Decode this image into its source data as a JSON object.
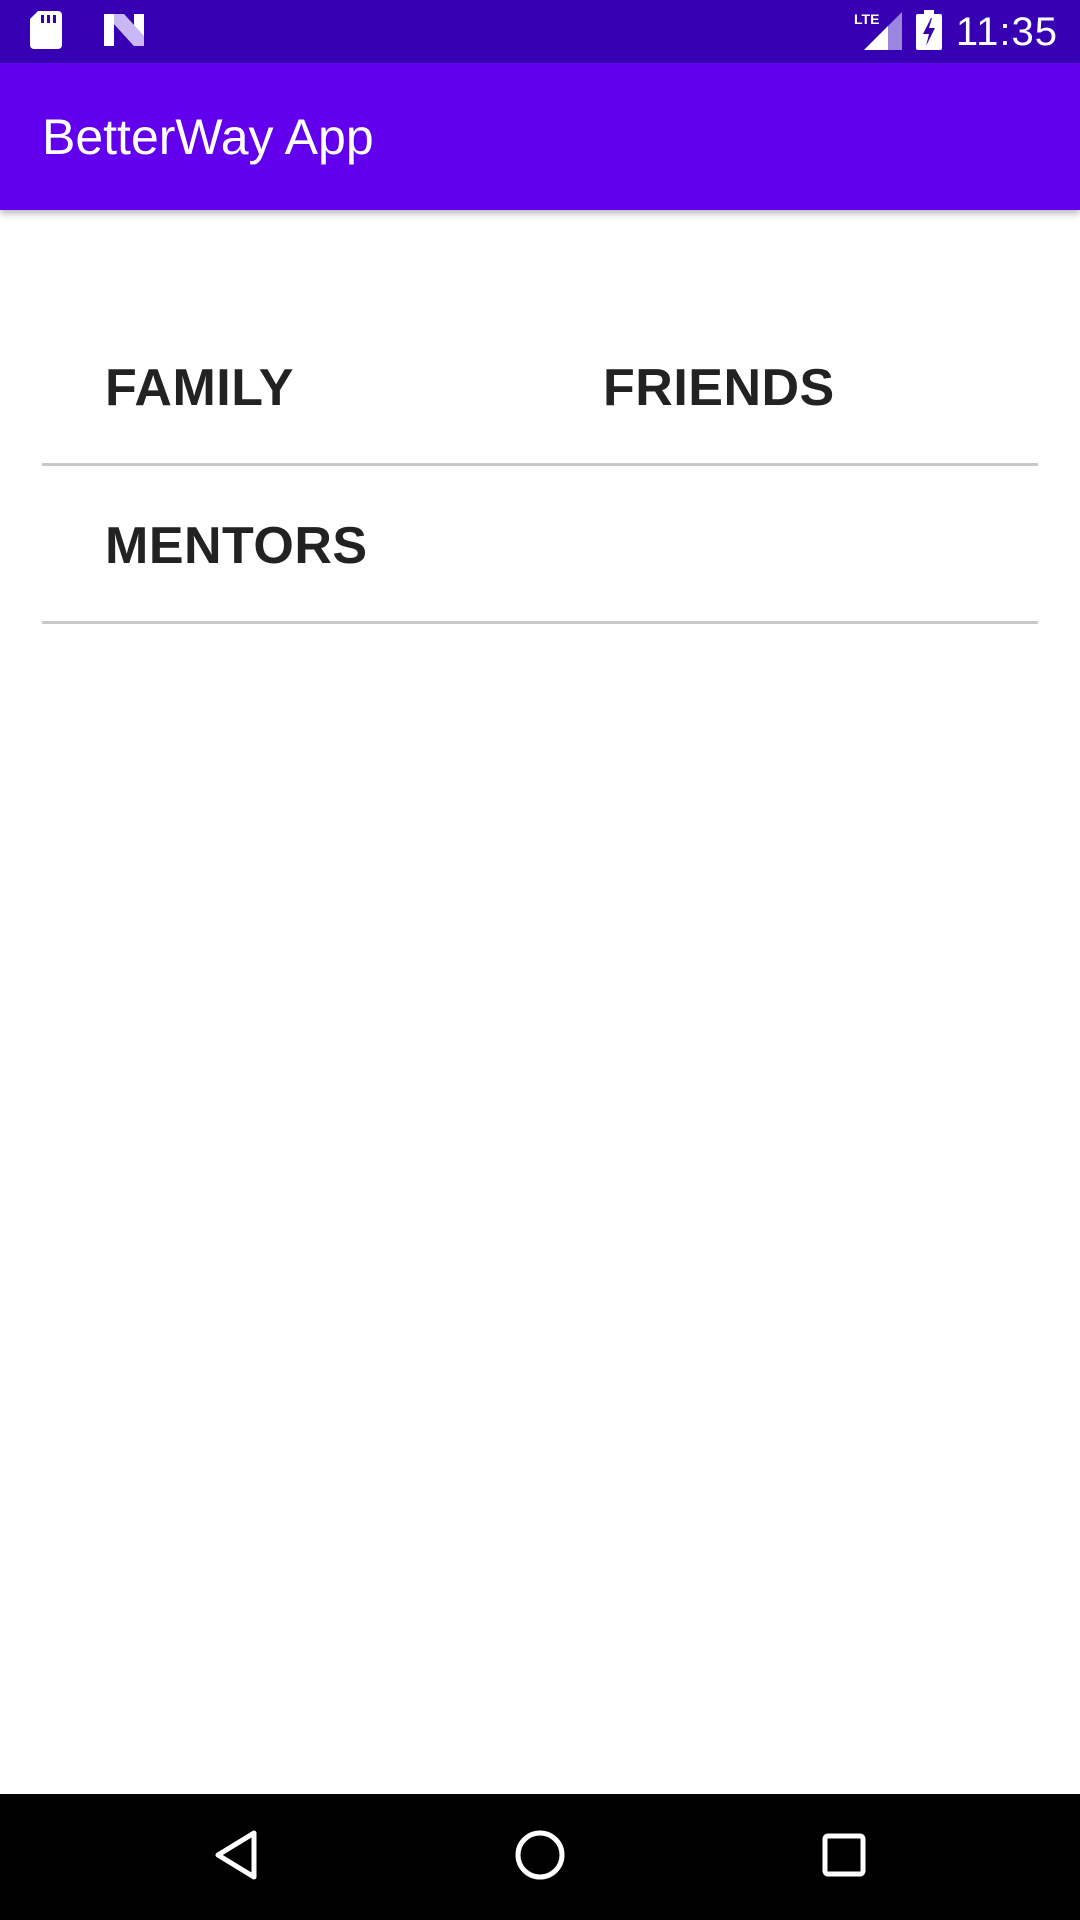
{
  "status_bar": {
    "time": "11:35",
    "left_icons": [
      "sd-card-icon",
      "n-logo-icon"
    ],
    "right_icons": [
      "lte-signal-icon",
      "battery-charging-icon"
    ],
    "network_label": "LTE",
    "color": "#3700B3"
  },
  "app_bar": {
    "title": "BetterWay App",
    "color": "#6200EE"
  },
  "categories": [
    {
      "label": "FAMILY"
    },
    {
      "label": "FRIENDS"
    },
    {
      "label": "MENTORS"
    }
  ],
  "nav_bar": {
    "icons": [
      "back-icon",
      "home-icon",
      "recents-icon"
    ]
  }
}
